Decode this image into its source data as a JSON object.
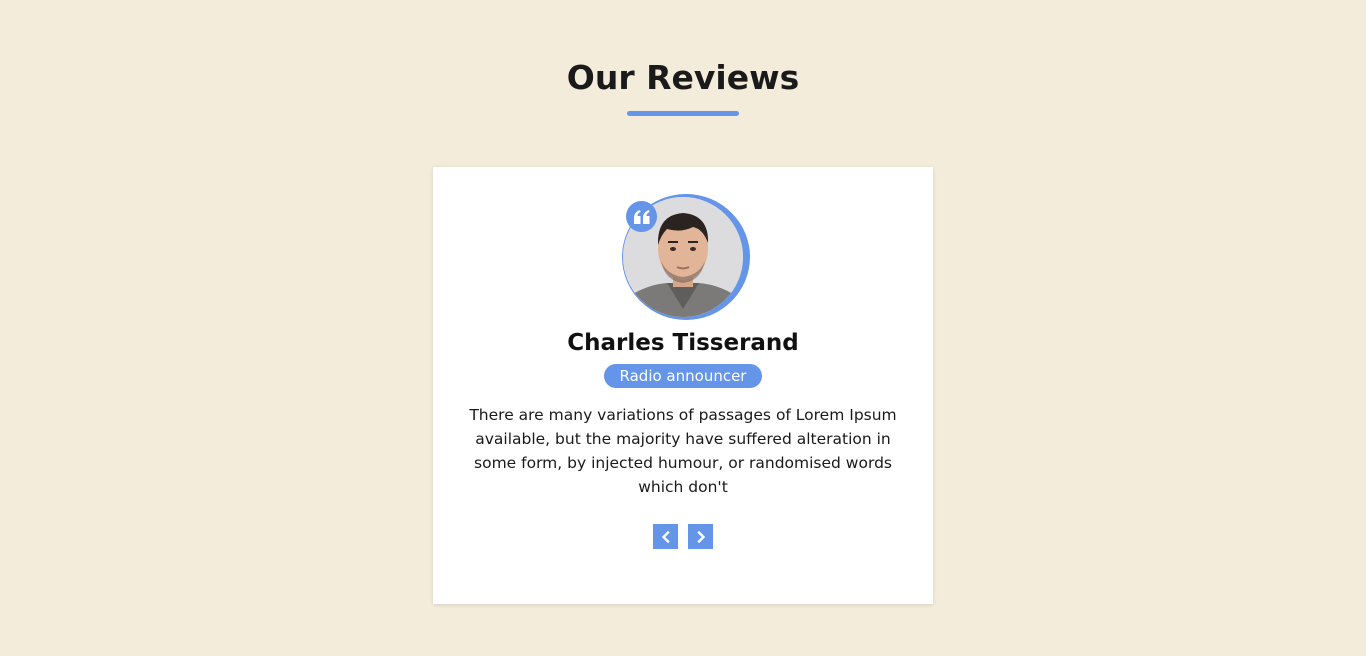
{
  "section": {
    "title": "Our Reviews"
  },
  "review_card": {
    "reviewer_name": "Charles Tisserand",
    "reviewer_role": "Radio announcer",
    "review_text": "There are many variations of passages of Lorem Ipsum available, but the majority have suffered alteration in some form, by injected humour, or randomised words which don't"
  },
  "icons": {
    "quote": "quote-left-icon",
    "prev": "chevron-left-icon",
    "next": "chevron-right-icon"
  },
  "colors": {
    "background": "#f4ecdb",
    "accent": "#6495e8",
    "card": "#ffffff",
    "text": "#1a1a1a"
  }
}
